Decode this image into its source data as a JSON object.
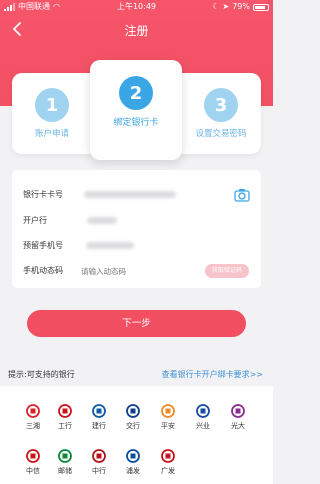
{
  "status_bar": {
    "carrier": "中国联通",
    "time": "上午10:49",
    "battery": "79%"
  },
  "nav": {
    "title": "注册"
  },
  "steps": [
    {
      "number": "1",
      "label": "账户申请"
    },
    {
      "number": "2",
      "label": "绑定银行卡"
    },
    {
      "number": "3",
      "label": "设置交易密码"
    }
  ],
  "form": {
    "card_number_label": "银行卡卡号",
    "bank_label": "开户行",
    "phone_label": "预留手机号",
    "code_label": "手机动态码",
    "code_placeholder": "请输入动态码",
    "code_button": "获取验证码"
  },
  "next_button": "下一步",
  "banks_section": {
    "tip": "提示:可支持的银行",
    "link": "查看银行卡开户绑卡要求>>",
    "items": [
      {
        "name": "三湘",
        "color": "#d6232e",
        "icon": "sanxiang-bank-icon"
      },
      {
        "name": "工行",
        "color": "#c8161d",
        "icon": "icbc-icon"
      },
      {
        "name": "建行",
        "color": "#0b5aa4",
        "icon": "ccb-icon"
      },
      {
        "name": "交行",
        "color": "#0f3f8c",
        "icon": "bocom-icon"
      },
      {
        "name": "平安",
        "color": "#f08a24",
        "icon": "pingan-icon"
      },
      {
        "name": "兴业",
        "color": "#1a4ba0",
        "icon": "cib-icon"
      },
      {
        "name": "光大",
        "color": "#8a2b8f",
        "icon": "ceb-icon"
      },
      {
        "name": "中信",
        "color": "#c8161d",
        "icon": "citic-icon"
      },
      {
        "name": "邮储",
        "color": "#0b8a3c",
        "icon": "psbc-icon"
      },
      {
        "name": "中行",
        "color": "#b5121b",
        "icon": "boc-icon"
      },
      {
        "name": "浦发",
        "color": "#0b4f9c",
        "icon": "spdb-icon"
      },
      {
        "name": "广发",
        "color": "#c8161d",
        "icon": "cgb-icon"
      }
    ]
  },
  "colors": {
    "brand": "#f34f62",
    "step_inactive": "#9fd3ef",
    "step_active": "#3aa6e6",
    "link": "#3c8fd8"
  }
}
